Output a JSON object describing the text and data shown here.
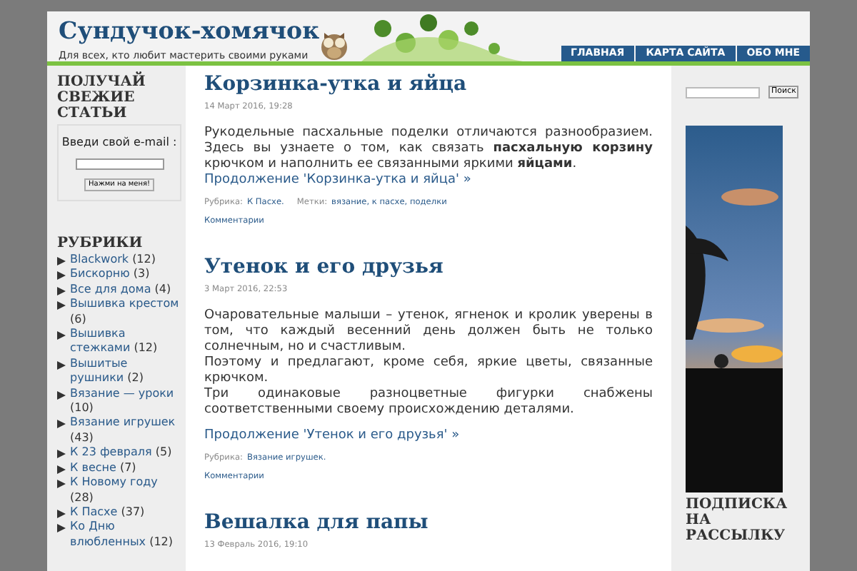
{
  "header": {
    "title": "Сундучок-хомячок",
    "tagline": "Для всех, кто любит мастерить своими руками"
  },
  "nav": [
    {
      "label": "ГЛАВНАЯ"
    },
    {
      "label": "КАРТА САЙТА"
    },
    {
      "label": "ОБО МНЕ"
    }
  ],
  "subscribe": {
    "heading": "ПОЛУЧАЙ СВЕЖИЕ СТАТЬИ",
    "prompt": "Введи свой e-mail :",
    "button": "Нажми на меня!"
  },
  "categories": {
    "heading": "РУБРИКИ",
    "items": [
      {
        "name": "Blackwork",
        "count": "(12)"
      },
      {
        "name": "Бискорню",
        "count": "(3)"
      },
      {
        "name": "Все для дома",
        "count": "(4)"
      },
      {
        "name": "Вышивка крестом",
        "count": "(6)"
      },
      {
        "name": "Вышивка стежками",
        "count": "(12)"
      },
      {
        "name": "Вышитые рушники",
        "count": "(2)"
      },
      {
        "name": "Вязание — уроки",
        "count": "(10)"
      },
      {
        "name": "Вязание игрушек",
        "count": "(43)"
      },
      {
        "name": "К 23 февраля",
        "count": "(5)"
      },
      {
        "name": "К весне",
        "count": "(7)"
      },
      {
        "name": "К Новому году",
        "count": "(28)"
      },
      {
        "name": "К Пасхе",
        "count": "(37)"
      },
      {
        "name": "Ко Дню влюбленных",
        "count": "(12)"
      }
    ]
  },
  "posts": [
    {
      "title": "Корзинка-утка и яйца",
      "date": "14 Март 2016, 19:28",
      "paragraphs": [
        "Рукодельные пасхальные поделки отличаются разнообразием. Здесь вы узнаете о том, как связать **пасхальную корзину** крючком и наполнить ее связанными яркими **яйцами**."
      ],
      "more": "Продолжение 'Корзинка-утка и яйца' »",
      "category_label": "Рубрика:",
      "category": "К Пасхе.",
      "tags_label": "Метки:",
      "tags": "вязание, к пасхе, поделки",
      "comments": "Комментарии"
    },
    {
      "title": "Утенок и его друзья",
      "date": "3 Март 2016, 22:53",
      "paragraphs": [
        "Очаровательные малыши – утенок, ягненок и кролик уверены в том, что каждый весенний день должен быть не только солнечным, но и счастливым.",
        "Поэтому и предлагают, кроме себя, яркие цветы, связанные крючком.",
        "Три одинаковые разноцветные фигурки снабжены соответственными своему происхождению деталями."
      ],
      "more": "Продолжение 'Утенок и его друзья' »",
      "category_label": "Рубрика:",
      "category": "Вязание игрушек.",
      "comments": "Комментарии"
    },
    {
      "title": "Вешалка для папы",
      "date": "13 Февраль 2016, 19:10"
    }
  ],
  "search": {
    "button": "Поиск"
  },
  "newsletter": {
    "heading": "ПОДПИСКА НА РАССЫЛКУ"
  }
}
